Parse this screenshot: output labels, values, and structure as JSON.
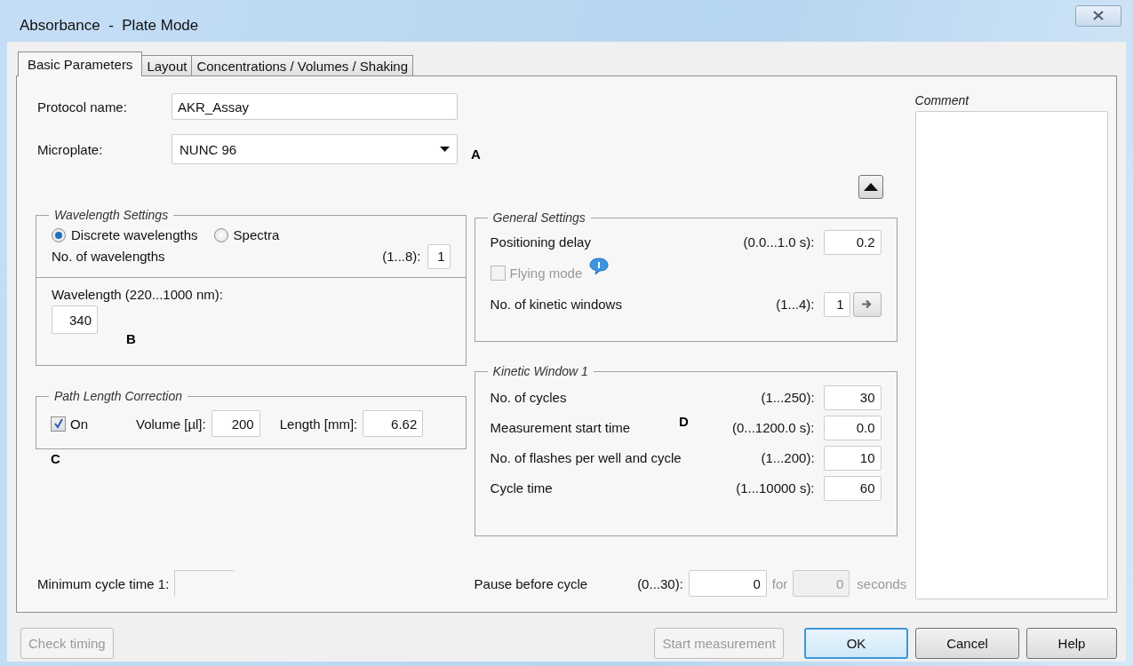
{
  "window": {
    "title": "Absorbance  -  Plate Mode"
  },
  "tabs": [
    {
      "label": "Basic Parameters",
      "selected": true
    },
    {
      "label": "Layout",
      "selected": false
    },
    {
      "label": "Concentrations / Volumes / Shaking",
      "selected": false
    }
  ],
  "protocol": {
    "label": "Protocol name:",
    "value": "AKR_Assay"
  },
  "microplate": {
    "label": "Microplate:",
    "value": "NUNC 96"
  },
  "wavelength_settings": {
    "title": "Wavelength Settings",
    "modes": [
      {
        "label": "Discrete wavelengths",
        "selected": true
      },
      {
        "label": "Spectra",
        "selected": false
      }
    ],
    "count": {
      "label": "No. of wavelengths",
      "range": "(1...8):",
      "value": "1"
    },
    "wavelength": {
      "label": "Wavelength (220...1000 nm):",
      "value": "340"
    }
  },
  "path_length": {
    "title": "Path Length Correction",
    "on": {
      "label": "On",
      "checked": true
    },
    "volume": {
      "label": "Volume [µl]:",
      "value": "200"
    },
    "length": {
      "label": "Length [mm]:",
      "value": "6.62"
    }
  },
  "general_settings": {
    "title": "General Settings",
    "rows": [
      {
        "kind": "field",
        "label": "Positioning delay",
        "range": "(0.0...1.0 s):",
        "value": "0.2"
      },
      {
        "kind": "checkbox",
        "label": "Flying mode",
        "checked": false,
        "disabled": true
      },
      {
        "kind": "field_arrow",
        "label": "No. of kinetic windows",
        "range": "(1...4):",
        "value": "1"
      }
    ]
  },
  "kinetic_window": {
    "title": "Kinetic Window 1",
    "rows": [
      {
        "kind": "field",
        "label": "No. of cycles",
        "range": "(1...250):",
        "value": "30"
      },
      {
        "kind": "field",
        "label": "Measurement start time",
        "range": "(0...1200.0 s):",
        "value": "0.0"
      },
      {
        "kind": "field",
        "label": "No. of flashes per well and cycle",
        "range": "(1...200):",
        "value": "10"
      },
      {
        "kind": "field",
        "label": "Cycle time",
        "range": "(1...10000 s):",
        "value": "60"
      }
    ]
  },
  "minimum_cycle_time": {
    "label": "Minimum cycle time 1:"
  },
  "pause": {
    "label": "Pause before cycle",
    "range": "(0...30):",
    "value": "0",
    "for_label": "for",
    "for_value": "0",
    "unit": "seconds"
  },
  "comment": {
    "label": "Comment"
  },
  "annotations": [
    "A",
    "B",
    "C",
    "D"
  ],
  "buttons": [
    {
      "label": "Check timing",
      "disabled": true,
      "focused": false
    },
    {
      "label": "Start measurement",
      "disabled": true,
      "focused": false
    },
    {
      "label": "OK",
      "disabled": false,
      "focused": true
    },
    {
      "label": "Cancel",
      "disabled": false,
      "focused": false
    },
    {
      "label": "Help",
      "disabled": false,
      "focused": false
    }
  ]
}
